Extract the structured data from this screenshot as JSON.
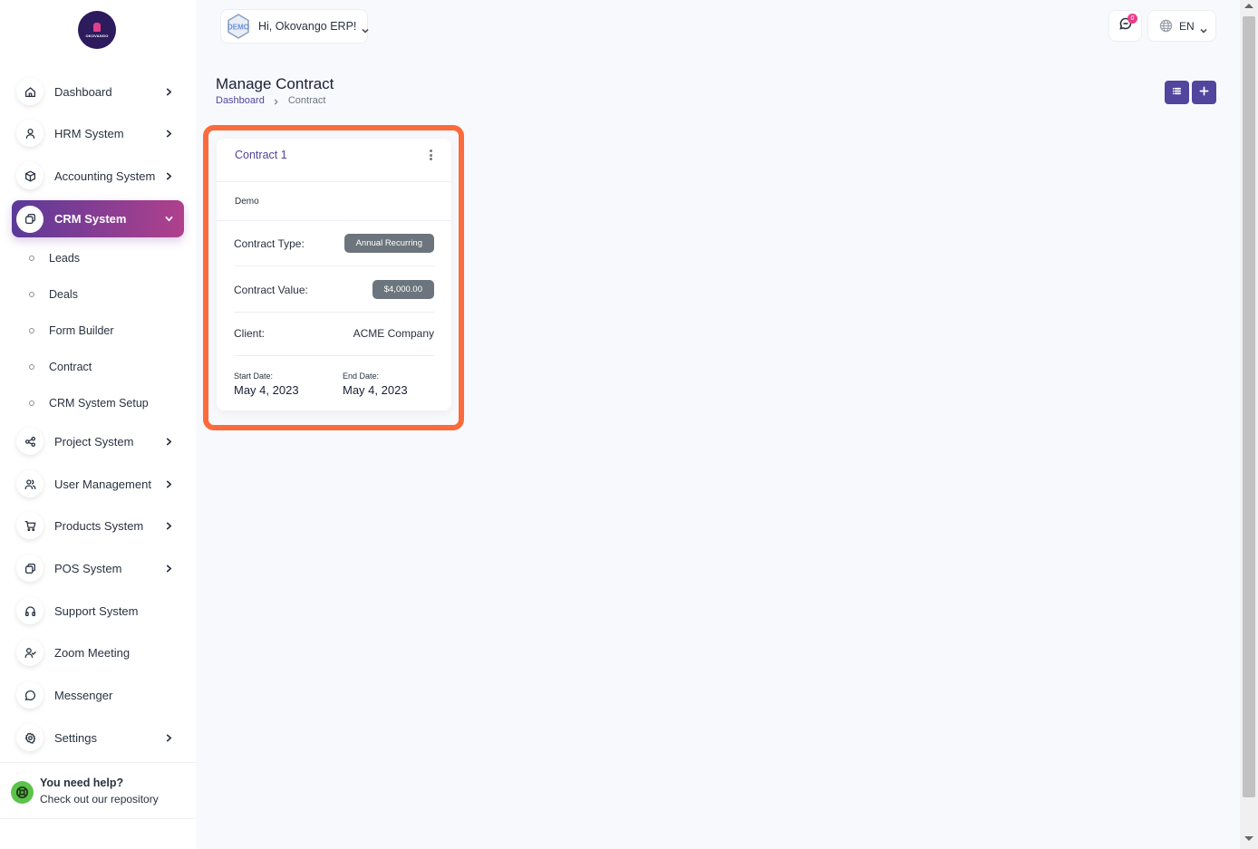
{
  "brand": {
    "logo_text": "OKOVANGO"
  },
  "sidebar": {
    "items": [
      {
        "label": "Dashboard",
        "icon": "home-icon",
        "chevron": true
      },
      {
        "label": "HRM System",
        "icon": "user-icon",
        "chevron": true
      },
      {
        "label": "Accounting System",
        "icon": "box-icon",
        "chevron": true
      },
      {
        "label": "CRM System",
        "icon": "layers-icon",
        "chevron": true,
        "active": true
      },
      {
        "label": "Project System",
        "icon": "share-icon",
        "chevron": true
      },
      {
        "label": "User Management",
        "icon": "users-icon",
        "chevron": true
      },
      {
        "label": "Products System",
        "icon": "cart-icon",
        "chevron": true
      },
      {
        "label": "POS System",
        "icon": "layers-icon",
        "chevron": true
      },
      {
        "label": "Support System",
        "icon": "headphones-icon",
        "chevron": false
      },
      {
        "label": "Zoom Meeting",
        "icon": "user-check-icon",
        "chevron": false
      },
      {
        "label": "Messenger",
        "icon": "message-icon",
        "chevron": false
      },
      {
        "label": "Settings",
        "icon": "gear-icon",
        "chevron": true
      }
    ],
    "crm_subitems": [
      "Leads",
      "Deals",
      "Form Builder",
      "Contract",
      "CRM System Setup"
    ],
    "help": {
      "title": "You need help?",
      "subtitle": "Check out our repository"
    }
  },
  "header": {
    "user_greeting": "Hi, Okovango ERP!",
    "avatar_text": "DEMO",
    "notification_count": "0",
    "language": "EN"
  },
  "page": {
    "title": "Manage Contract",
    "breadcrumb": [
      "Dashboard",
      "Contract"
    ]
  },
  "contract_card": {
    "title": "Contract 1",
    "description": "Demo",
    "type_label": "Contract Type:",
    "type_value": "Annual Recurring",
    "value_label": "Contract Value:",
    "value_value": "$4,000.00",
    "client_label": "Client:",
    "client_value": "ACME Company",
    "start_label": "Start Date:",
    "start_value": "May 4, 2023",
    "end_label": "End Date:",
    "end_value": "May 4, 2023"
  },
  "colors": {
    "primary": "#51459d",
    "active_gradient_start": "#5b3a99",
    "active_gradient_end": "#b0408c",
    "highlight": "#fb6b3b",
    "badge": "#e83e8c",
    "pill": "#6c757d"
  }
}
